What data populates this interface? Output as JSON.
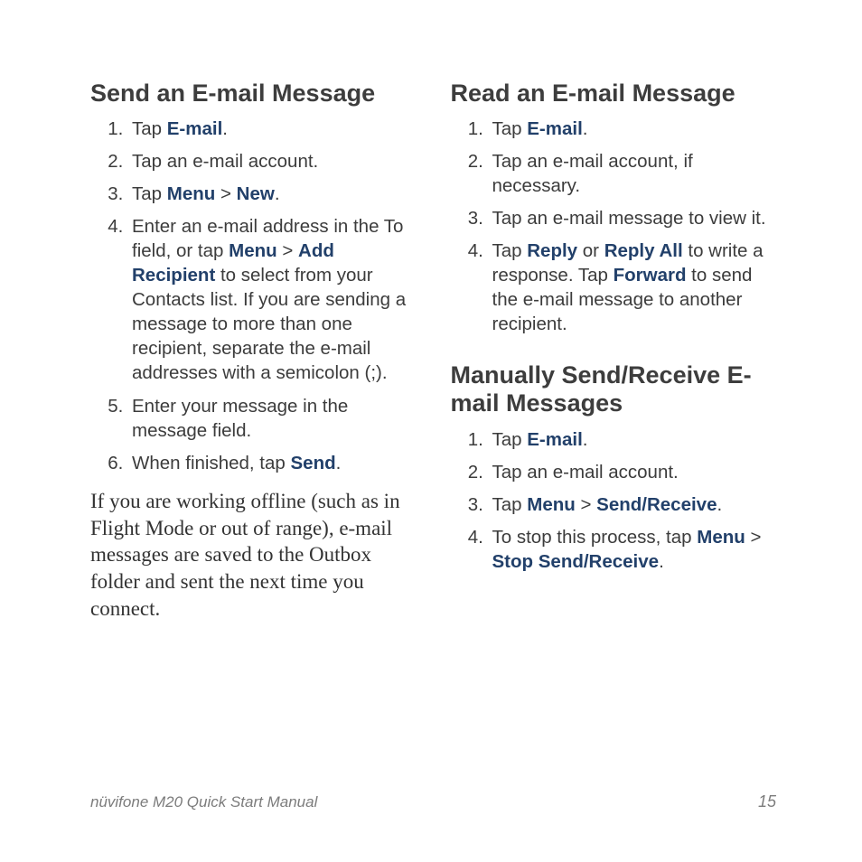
{
  "left": {
    "heading": "Send an E-mail Message",
    "steps": [
      [
        {
          "t": "Tap "
        },
        {
          "t": "E-mail",
          "em": true
        },
        {
          "t": "."
        }
      ],
      [
        {
          "t": "Tap an e-mail account."
        }
      ],
      [
        {
          "t": "Tap "
        },
        {
          "t": "Menu",
          "em": true
        },
        {
          "t": " > "
        },
        {
          "t": "New",
          "em": true
        },
        {
          "t": "."
        }
      ],
      [
        {
          "t": "Enter an e-mail address in the To field, or tap "
        },
        {
          "t": "Menu",
          "em": true
        },
        {
          "t": " > "
        },
        {
          "t": "Add Recipient",
          "em": true
        },
        {
          "t": " to select from your Contacts list. If you are sending a message to more than one recipient, separate the e-mail addresses with a semicolon (;)."
        }
      ],
      [
        {
          "t": "Enter your message in the message field."
        }
      ],
      [
        {
          "t": "When finished, tap "
        },
        {
          "t": "Send",
          "em": true
        },
        {
          "t": "."
        }
      ]
    ],
    "note": "If you are working offline (such as in Flight Mode or out of range), e-mail messages are saved to the Outbox folder and sent the next time you connect."
  },
  "right": {
    "section1": {
      "heading": "Read an E-mail Message",
      "steps": [
        [
          {
            "t": "Tap "
          },
          {
            "t": "E-mail",
            "em": true
          },
          {
            "t": "."
          }
        ],
        [
          {
            "t": "Tap an e-mail account, if necessary."
          }
        ],
        [
          {
            "t": "Tap an e-mail message to view it."
          }
        ],
        [
          {
            "t": "Tap "
          },
          {
            "t": "Reply",
            "em": true
          },
          {
            "t": " or "
          },
          {
            "t": "Reply All",
            "em": true
          },
          {
            "t": " to write a response. Tap "
          },
          {
            "t": "Forward",
            "em": true
          },
          {
            "t": " to send the e-mail message to another recipient."
          }
        ]
      ]
    },
    "section2": {
      "heading": "Manually Send/Receive E-mail Messages",
      "steps": [
        [
          {
            "t": "Tap "
          },
          {
            "t": "E-mail",
            "em": true
          },
          {
            "t": "."
          }
        ],
        [
          {
            "t": "Tap an e-mail account."
          }
        ],
        [
          {
            "t": "Tap "
          },
          {
            "t": "Menu",
            "em": true
          },
          {
            "t": " > "
          },
          {
            "t": "Send/Receive",
            "em": true
          },
          {
            "t": "."
          }
        ],
        [
          {
            "t": "To stop this process, tap "
          },
          {
            "t": "Menu",
            "em": true
          },
          {
            "t": " > "
          },
          {
            "t": "Stop Send/Receive",
            "em": true
          },
          {
            "t": "."
          }
        ]
      ]
    }
  },
  "footer": {
    "title": "nüvifone M20 Quick Start Manual",
    "page": "15"
  }
}
